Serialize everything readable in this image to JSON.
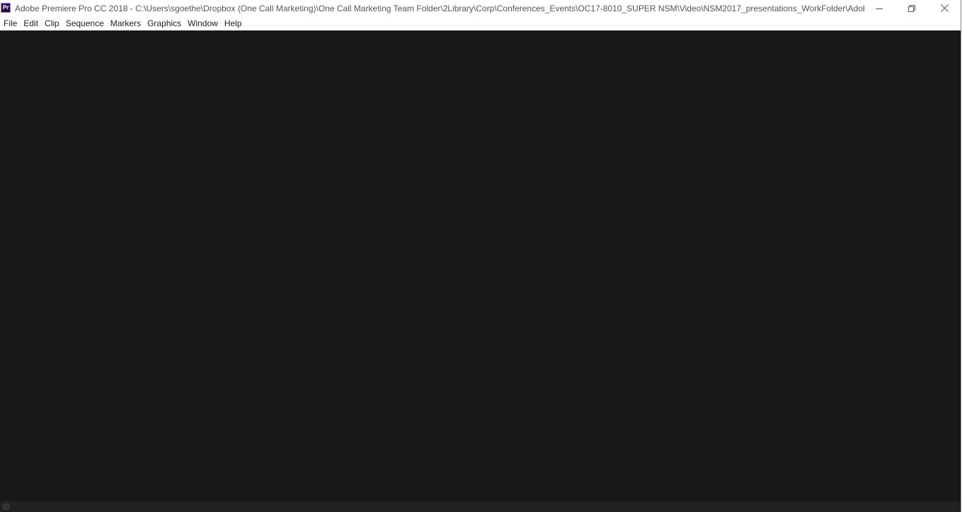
{
  "window": {
    "title": "Adobe Premiere Pro CC 2018 - C:\\Users\\sgoethe\\Dropbox (One Call Marketing)\\One Call Marketing Team Folder\\2Library\\Corp\\Conferences_Events\\OC17-8010_SUPER NSM\\Video\\NSM2017_presentations_WorkFolder\\Adobe ...",
    "app_icon_label": "Pr",
    "app_icon": "premiere-pro-icon",
    "controls": {
      "minimize_icon": "minimize-icon",
      "restore_icon": "restore-icon",
      "close_icon": "close-icon"
    }
  },
  "menubar": {
    "items": [
      {
        "label": "File"
      },
      {
        "label": "Edit"
      },
      {
        "label": "Clip"
      },
      {
        "label": "Sequence"
      },
      {
        "label": "Markers"
      },
      {
        "label": "Graphics"
      },
      {
        "label": "Window"
      },
      {
        "label": "Help"
      }
    ]
  },
  "status": {
    "indicator_icon": "busy-indicator-icon"
  },
  "colors": {
    "titlebar_bg": "#ffffff",
    "workspace_bg": "#181818",
    "statusbar_bg": "#222222",
    "window_border": "#2aa0d8",
    "app_icon_bg": "#2b0a3d",
    "app_icon_accent": "#9a7cff"
  }
}
